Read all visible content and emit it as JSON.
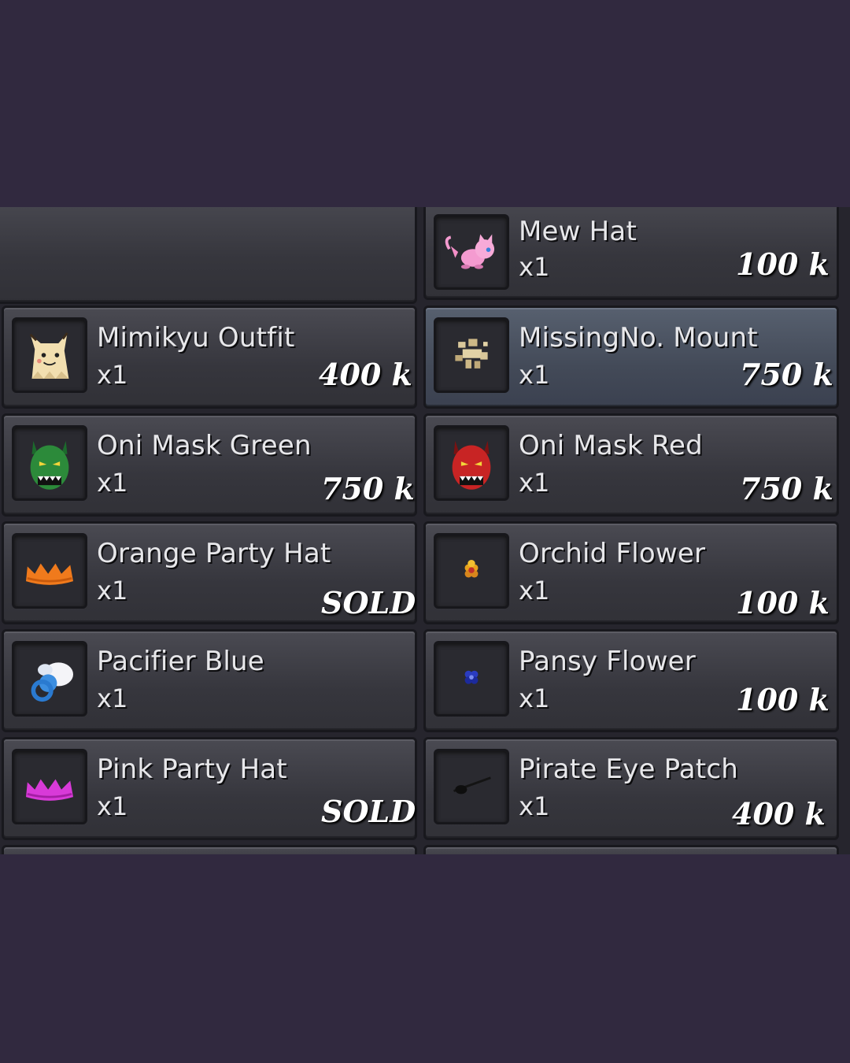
{
  "items": [
    {
      "name": "Mew Hat",
      "qty": "x1",
      "price": "100 k",
      "icon": "mew-hat-icon"
    },
    {
      "name": "Mimikyu Outfit",
      "qty": "x1",
      "price": "400 k",
      "icon": "mimikyu-outfit-icon"
    },
    {
      "name": "MissingNo. Mount",
      "qty": "x1",
      "price": "750 k",
      "icon": "missingno-mount-icon",
      "highlighted": true
    },
    {
      "name": "Oni Mask Green",
      "qty": "x1",
      "price": "750 k",
      "icon": "oni-mask-green-icon"
    },
    {
      "name": "Oni Mask Red",
      "qty": "x1",
      "price": "750 k",
      "icon": "oni-mask-red-icon"
    },
    {
      "name": "Orange Party Hat",
      "qty": "x1",
      "price": "SOLD",
      "icon": "orange-party-hat-icon"
    },
    {
      "name": "Orchid Flower",
      "qty": "x1",
      "price": "100 k",
      "icon": "orchid-flower-icon"
    },
    {
      "name": "Pacifier Blue",
      "qty": "x1",
      "price": "",
      "icon": "pacifier-blue-icon"
    },
    {
      "name": "Pansy Flower",
      "qty": "x1",
      "price": "100 k",
      "icon": "pansy-flower-icon"
    },
    {
      "name": "Pink Party Hat",
      "qty": "x1",
      "price": "SOLD",
      "icon": "pink-party-hat-icon"
    },
    {
      "name": "Pirate Eye Patch",
      "qty": "x1",
      "price": "400 k",
      "icon": "pirate-eye-patch-icon"
    }
  ],
  "colors": {
    "background": "#31293f",
    "panel": "#26252d",
    "card": "#3a3a41",
    "highlight_card": "#4a5262",
    "text": "#e7e7ea"
  }
}
